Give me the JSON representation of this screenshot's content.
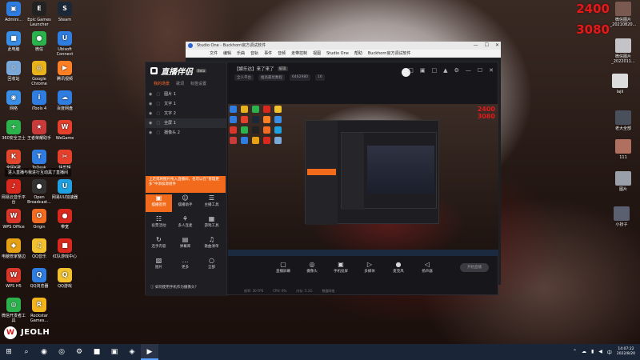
{
  "desktop": {
    "icons": [
      {
        "label": "Admini...",
        "color": "#2f7de1",
        "glyph": "▣"
      },
      {
        "label": "此电脑",
        "color": "#3a8ee6",
        "glyph": "■"
      },
      {
        "label": "回收站",
        "color": "#7aa8d8",
        "glyph": "♲"
      },
      {
        "label": "网络",
        "color": "#3a8ee6",
        "glyph": "◉"
      },
      {
        "label": "360安全卫士",
        "color": "#2bb24c",
        "glyph": "+"
      },
      {
        "label": "全民K歌",
        "color": "#e2462c",
        "glyph": "K"
      },
      {
        "label": "网易云音乐平台",
        "color": "#d9281e",
        "glyph": "♪"
      },
      {
        "label": "WPS Office",
        "color": "#d8372a",
        "glyph": "W"
      },
      {
        "label": "电脑管家整边",
        "color": "#e6a117",
        "glyph": "◆"
      },
      {
        "label": "WPS H5",
        "color": "#d8372a",
        "glyph": "W"
      },
      {
        "label": "微信开发者工具",
        "color": "#2bb24c",
        "glyph": "◎"
      },
      {
        "label": "Epic Games Launcher",
        "color": "#222222",
        "glyph": "E"
      },
      {
        "label": "微信",
        "color": "#2bb24c",
        "glyph": "●"
      },
      {
        "label": "Google Chrome",
        "color": "#e8b21c",
        "glyph": "◎"
      },
      {
        "label": "iTools 4",
        "color": "#2f7de1",
        "glyph": "i"
      },
      {
        "label": "王者荣耀助手",
        "color": "#c93b3b",
        "glyph": "★"
      },
      {
        "label": "ToDesk",
        "color": "#2f7de1",
        "glyph": "T"
      },
      {
        "label": "Open Broadcast...",
        "color": "#333333",
        "glyph": "●"
      },
      {
        "label": "Origin",
        "color": "#f36c21",
        "glyph": "O"
      },
      {
        "label": "QQ音乐",
        "color": "#f2c12e",
        "glyph": "♫"
      },
      {
        "label": "QQ浏览器",
        "color": "#2f7de1",
        "glyph": "Q"
      },
      {
        "label": "Rockstar Games...",
        "color": "#f2b51c",
        "glyph": "R"
      },
      {
        "label": "Steam",
        "color": "#1b2838",
        "glyph": "S"
      },
      {
        "label": "Ubisoft Connect",
        "color": "#2f7de1",
        "glyph": "U"
      },
      {
        "label": "腾讯视频",
        "color": "#ff7f24",
        "glyph": "▶"
      },
      {
        "label": "百度网盘",
        "color": "#2f7de1",
        "glyph": "☁"
      },
      {
        "label": "WeGame",
        "color": "#e4402c",
        "glyph": "W"
      },
      {
        "label": "快剪辑",
        "color": "#e4402c",
        "glyph": "✂"
      },
      {
        "label": "网易UU加速器",
        "color": "#1fa0e0",
        "glyph": "U"
      },
      {
        "label": "带宽",
        "color": "#d9281e",
        "glyph": "●"
      },
      {
        "label": "红队游戏中心",
        "color": "#d9281e",
        "glyph": "■"
      },
      {
        "label": "QQ游戏",
        "color": "#f2c12e",
        "glyph": "Q"
      }
    ],
    "counter_top": "2400",
    "counter_bottom": "3080",
    "notification": "进入直播与我进行互动黑了直播间",
    "brand_text": "JEOLH",
    "right_icons": [
      {
        "label": "微信图片_20210820..."
      },
      {
        "label": "微信图片_2022011..."
      },
      {
        "label": "lajii"
      },
      {
        "label": "老大全部"
      },
      {
        "label": "111"
      },
      {
        "label": "图片"
      },
      {
        "label": "小扮子"
      }
    ]
  },
  "studio_one": {
    "title": "Studio One - Buckhorn官方调试软件",
    "menu": [
      "文件",
      "编辑",
      "乐曲",
      "音轨",
      "事件",
      "音频",
      "走带控制",
      "视图",
      "Studio One",
      "帮助",
      "Buckhorn官方调试软件"
    ]
  },
  "live_app": {
    "brand": "直播伴侣",
    "brand_tag": "Beta",
    "source_tabs": [
      "我的场景",
      "歌词",
      "标签设置"
    ],
    "sources": [
      {
        "name": "图片 1",
        "selected": false
      },
      {
        "name": "文字 1",
        "selected": false
      },
      {
        "name": "文字 2",
        "selected": false
      },
      {
        "name": "全屏 1",
        "selected": true
      },
      {
        "name": "摄像头 2",
        "selected": false
      }
    ],
    "promo": "上走或将图片拖入直播间，也可以在“管理更多”中添加源组件",
    "tools": [
      {
        "label": "摆播签到",
        "glyph": "▣",
        "active": true
      },
      {
        "label": "摆播助手",
        "glyph": "☺",
        "active": false
      },
      {
        "label": "主播工具",
        "glyph": "☰",
        "active": false
      },
      {
        "label": "投票活动",
        "glyph": "☷",
        "active": false
      },
      {
        "label": "多人连麦",
        "glyph": "⚘",
        "active": false
      },
      {
        "label": "游戏工具",
        "glyph": "▦",
        "active": false
      },
      {
        "label": "连手内容",
        "glyph": "↻",
        "active": false
      },
      {
        "label": "弹幕库",
        "glyph": "▤",
        "active": false
      },
      {
        "label": "歌曲清单",
        "glyph": "♫",
        "active": false
      },
      {
        "label": "图片",
        "glyph": "▧",
        "active": false
      },
      {
        "label": "更多",
        "glyph": "…",
        "active": false
      },
      {
        "label": "全部",
        "glyph": "○",
        "active": false
      }
    ],
    "bottom_tip": "如何使用手机作为摄像头？",
    "room_title": "【娱乐达】来了来了",
    "room_edit": "编辑",
    "room_tags": [
      "全人平台",
      "推高最优数程",
      "6462980",
      "16"
    ],
    "controls": [
      {
        "label": "直播屏幕",
        "glyph": "▢"
      },
      {
        "label": "摄像头",
        "glyph": "◎"
      },
      {
        "label": "手机投屏",
        "glyph": "▣"
      },
      {
        "label": "多媒体",
        "glyph": "▷"
      },
      {
        "label": "麦克风",
        "glyph": "●"
      },
      {
        "label": "扬声器",
        "glyph": "◁"
      }
    ],
    "go_live": "开始直播",
    "status_items": [
      "帧率: 30 FPS",
      "CPU: 6%",
      "内存: 5.1G",
      "数据网络"
    ]
  },
  "taskbar": {
    "items": [
      "⊞",
      "⌕",
      "◉",
      "◎",
      "⚙",
      "■",
      "▣",
      "◈",
      "▶"
    ],
    "tray_icons": [
      "⌃",
      "☁",
      "▮",
      "◀",
      "中"
    ],
    "time": "14:07:22",
    "date": "2022/8/20"
  }
}
